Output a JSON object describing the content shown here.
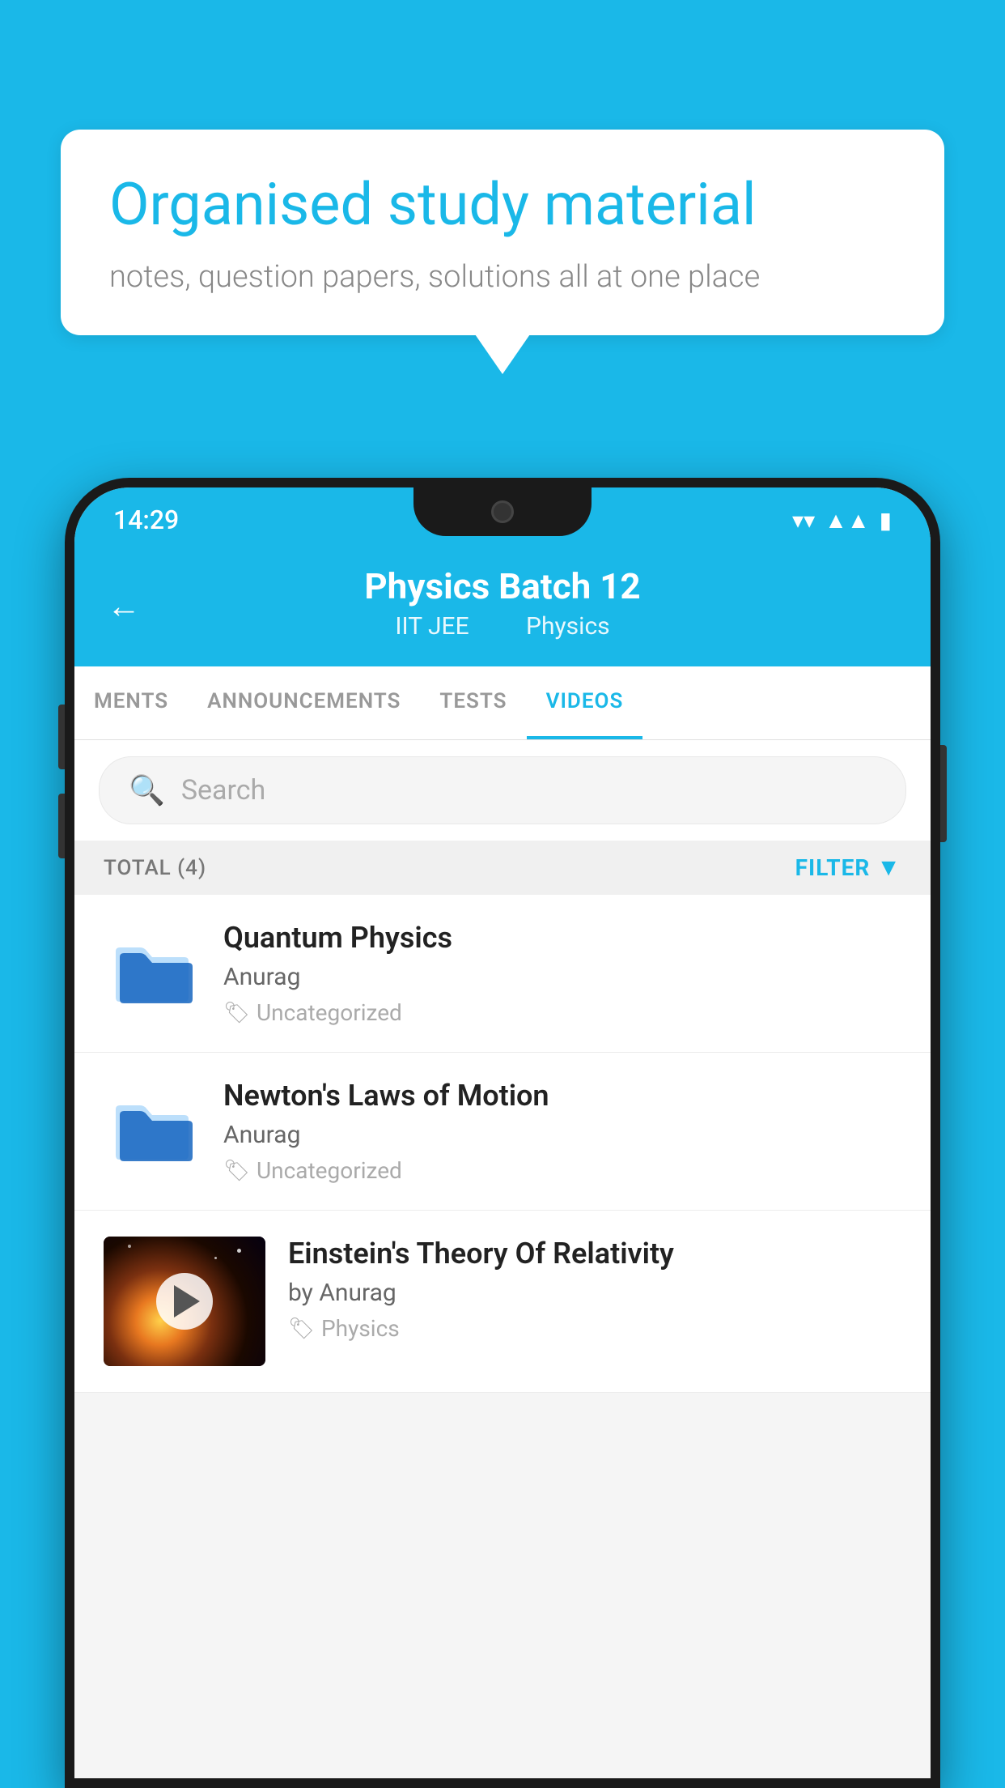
{
  "background_color": "#1ab8e8",
  "speech_bubble": {
    "title": "Organised study material",
    "subtitle": "notes, question papers, solutions all at one place"
  },
  "status_bar": {
    "time": "14:29",
    "wifi": "▾",
    "signal": "▲",
    "battery": "▮"
  },
  "header": {
    "back_label": "←",
    "title": "Physics Batch 12",
    "subtitle_left": "IIT JEE",
    "subtitle_right": "Physics"
  },
  "tabs": [
    {
      "label": "MENTS",
      "active": false
    },
    {
      "label": "ANNOUNCEMENTS",
      "active": false
    },
    {
      "label": "TESTS",
      "active": false
    },
    {
      "label": "VIDEOS",
      "active": true
    }
  ],
  "search": {
    "placeholder": "Search"
  },
  "filter_row": {
    "total_label": "TOTAL (4)",
    "filter_label": "FILTER"
  },
  "videos": [
    {
      "title": "Quantum Physics",
      "author": "Anurag",
      "tag": "Uncategorized",
      "has_thumb": false
    },
    {
      "title": "Newton's Laws of Motion",
      "author": "Anurag",
      "tag": "Uncategorized",
      "has_thumb": false
    },
    {
      "title": "Einstein's Theory Of Relativity",
      "author": "by Anurag",
      "tag": "Physics",
      "has_thumb": true
    }
  ]
}
